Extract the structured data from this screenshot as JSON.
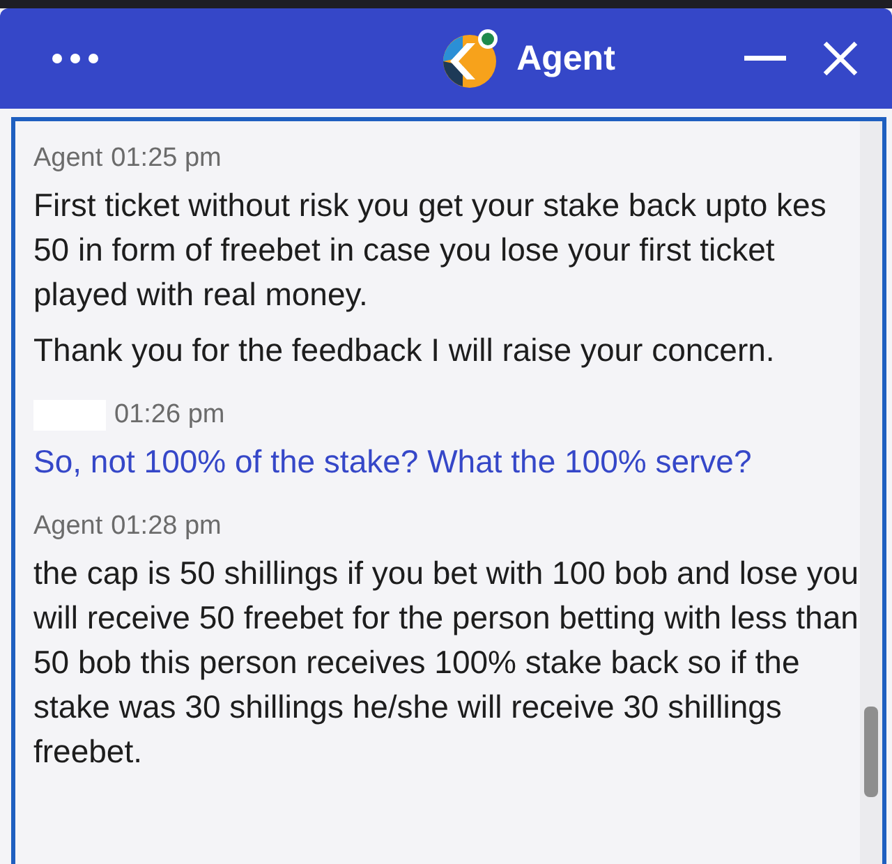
{
  "header": {
    "title": "Agent"
  },
  "messages": [
    {
      "kind": "agent",
      "sender": "Agent",
      "time": "01:25 pm",
      "paragraphs": [
        "First ticket without risk you get your stake back upto kes 50 in form of freebet in case you lose your first ticket played with real money.",
        "Thank you for the feedback I will raise your concern."
      ]
    },
    {
      "kind": "user",
      "time": "01:26 pm",
      "paragraphs": [
        "So, not 100% of the stake? What the 100% serve?"
      ]
    },
    {
      "kind": "agent",
      "sender": "Agent",
      "time": "01:28 pm",
      "paragraphs": [
        "the cap is 50 shillings if you bet with 100 bob and lose you will receive 50 freebet for the person betting with less than 50 bob this person receives 100% stake back so if the stake was 30 shillings he/she will receive 30 shillings freebet."
      ]
    }
  ]
}
